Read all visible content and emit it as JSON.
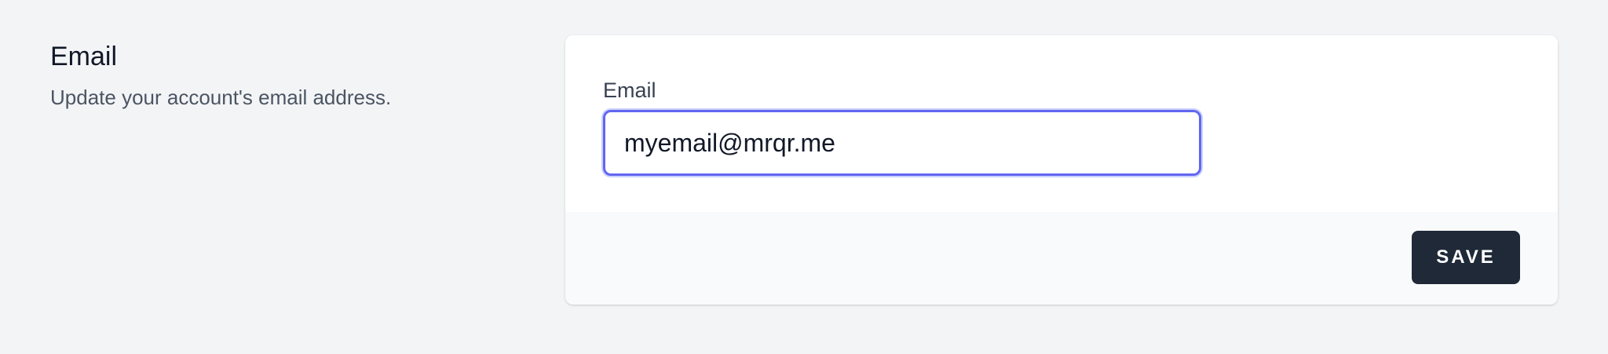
{
  "section": {
    "title": "Email",
    "description": "Update your account's email address."
  },
  "form": {
    "email_label": "Email",
    "email_value": "myemail@mrqr.me"
  },
  "footer": {
    "save_label": "SAVE"
  },
  "colors": {
    "focus_ring": "#6366f1",
    "button_bg": "#1f2937",
    "page_bg": "#f3f4f6"
  }
}
